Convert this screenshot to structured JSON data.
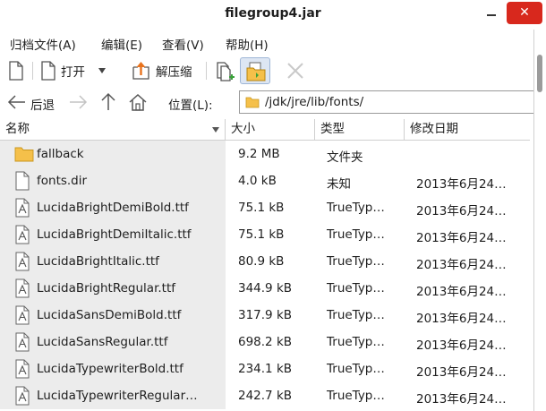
{
  "window": {
    "title": "filegroup4.jar",
    "close_glyph": "✕"
  },
  "menu": [
    {
      "label": "归档文件(A)"
    },
    {
      "label": "编辑(E)"
    },
    {
      "label": "查看(V)"
    },
    {
      "label": "帮助(H)"
    }
  ],
  "toolbar": {
    "open_label": "打开",
    "extract_label": "解压缩"
  },
  "nav": {
    "back_label": "后退",
    "location_label": "位置(L):",
    "location_path": "/jdk/jre/lib/fonts/"
  },
  "columns": {
    "name": "名称",
    "size": "大小",
    "type": "类型",
    "modified": "修改日期"
  },
  "rows": [
    {
      "icon": "folder-icon",
      "name": "fallback",
      "size": "9.2 MB",
      "type": "文件夹",
      "date": ""
    },
    {
      "icon": "file-icon",
      "name": "fonts.dir",
      "size": "4.0 kB",
      "type": "未知",
      "date": "2013年6月24…"
    },
    {
      "icon": "font-file-icon",
      "name": "LucidaBrightDemiBold.ttf",
      "size": "75.1 kB",
      "type": "TrueTyp…",
      "date": "2013年6月24…"
    },
    {
      "icon": "font-file-icon",
      "name": "LucidaBrightDemiItalic.ttf",
      "size": "75.1 kB",
      "type": "TrueTyp…",
      "date": "2013年6月24…"
    },
    {
      "icon": "font-file-icon",
      "name": "LucidaBrightItalic.ttf",
      "size": "80.9 kB",
      "type": "TrueTyp…",
      "date": "2013年6月24…"
    },
    {
      "icon": "font-file-icon",
      "name": "LucidaBrightRegular.ttf",
      "size": "344.9 kB",
      "type": "TrueTyp…",
      "date": "2013年6月24…"
    },
    {
      "icon": "font-file-icon",
      "name": "LucidaSansDemiBold.ttf",
      "size": "317.9 kB",
      "type": "TrueTyp…",
      "date": "2013年6月24…"
    },
    {
      "icon": "font-file-icon",
      "name": "LucidaSansRegular.ttf",
      "size": "698.2 kB",
      "type": "TrueTyp…",
      "date": "2013年6月24…"
    },
    {
      "icon": "font-file-icon",
      "name": "LucidaTypewriterBold.ttf",
      "size": "234.1 kB",
      "type": "TrueTyp…",
      "date": "2013年6月24…"
    },
    {
      "icon": "font-file-icon",
      "name": "LucidaTypewriterRegular…",
      "size": "242.7 kB",
      "type": "TrueTyp…",
      "date": "2013年6月24…"
    }
  ],
  "colors": {
    "close_button": "#d8281d",
    "folder": "#f5c04a",
    "name_column_bg": "#ececec",
    "extract_arrow": "#e8731e"
  }
}
